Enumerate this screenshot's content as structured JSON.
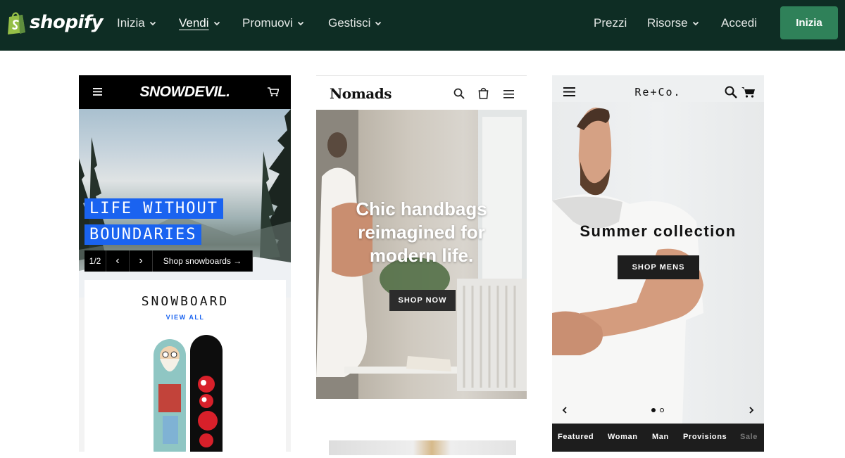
{
  "header": {
    "brand": "shopify",
    "nav": [
      {
        "label": "Inizia",
        "active": false
      },
      {
        "label": "Vendi",
        "active": true
      },
      {
        "label": "Promuovi",
        "active": false
      },
      {
        "label": "Gestisci",
        "active": false
      }
    ],
    "right_nav": [
      {
        "label": "Prezzi",
        "has_dropdown": false
      },
      {
        "label": "Risorse",
        "has_dropdown": true
      },
      {
        "label": "Accedi",
        "has_dropdown": false
      }
    ],
    "cta_label": "Inizia",
    "colors": {
      "background": "#0e2d24",
      "cta": "#2f8159",
      "logo_green": "#95bf47"
    }
  },
  "stores": {
    "snowdevil": {
      "logo": "SNOWDEVIL.",
      "hero_line1": "LIFE WITHOUT",
      "hero_line2": "BOUNDARIES",
      "slide_counter": "1/2",
      "prev": "‹",
      "next": "›",
      "shop_link": "Shop snowboards →",
      "section_title": "SNOWBOARD",
      "view_all": "VIEW ALL",
      "accent": "#1a63f0"
    },
    "nomads": {
      "logo": "Nomads",
      "hero_line1": "Chic handbags",
      "hero_line2": "reimagined for",
      "hero_line3": "modern life.",
      "button": "SHOP NOW"
    },
    "reco": {
      "logo": "Re+Co.",
      "hero_title": "Summer collection",
      "button": "SHOP MENS",
      "tabs": [
        "Featured",
        "Woman",
        "Man",
        "Provisions",
        "Sale"
      ],
      "slide_count": 2,
      "active_slide": 1
    }
  }
}
